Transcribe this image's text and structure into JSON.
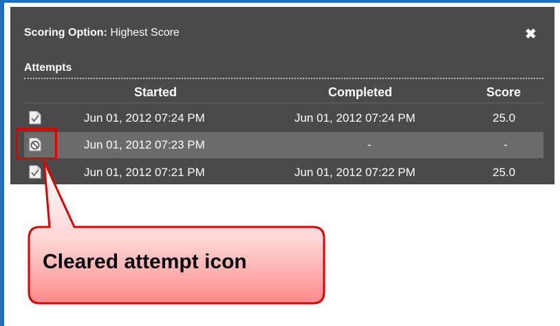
{
  "dialog": {
    "scoring_label": "Scoring Option:",
    "scoring_value": "Highest Score",
    "close_glyph": "✖",
    "attempts_title": "Attempts"
  },
  "table": {
    "headers": [
      "Started",
      "Completed",
      "Score"
    ],
    "rows": [
      {
        "icon": "completed-attempt-icon",
        "started": "Jun 01, 2012 07:24 PM",
        "completed": "Jun 01, 2012 07:24 PM",
        "score": "25.0"
      },
      {
        "icon": "cleared-attempt-icon",
        "started": "Jun 01, 2012 07:23 PM",
        "completed": "-",
        "score": "-"
      },
      {
        "icon": "completed-attempt-icon",
        "started": "Jun 01, 2012 07:21 PM",
        "completed": "Jun 01, 2012 07:22 PM",
        "score": "25.0"
      }
    ]
  },
  "callout": {
    "text": "Cleared attempt icon"
  },
  "colors": {
    "panel": "#4a4a4a",
    "highlight_row": "#6b6b6b",
    "callout_red": "#e00000",
    "frame_blue": "#1f6fbf"
  }
}
